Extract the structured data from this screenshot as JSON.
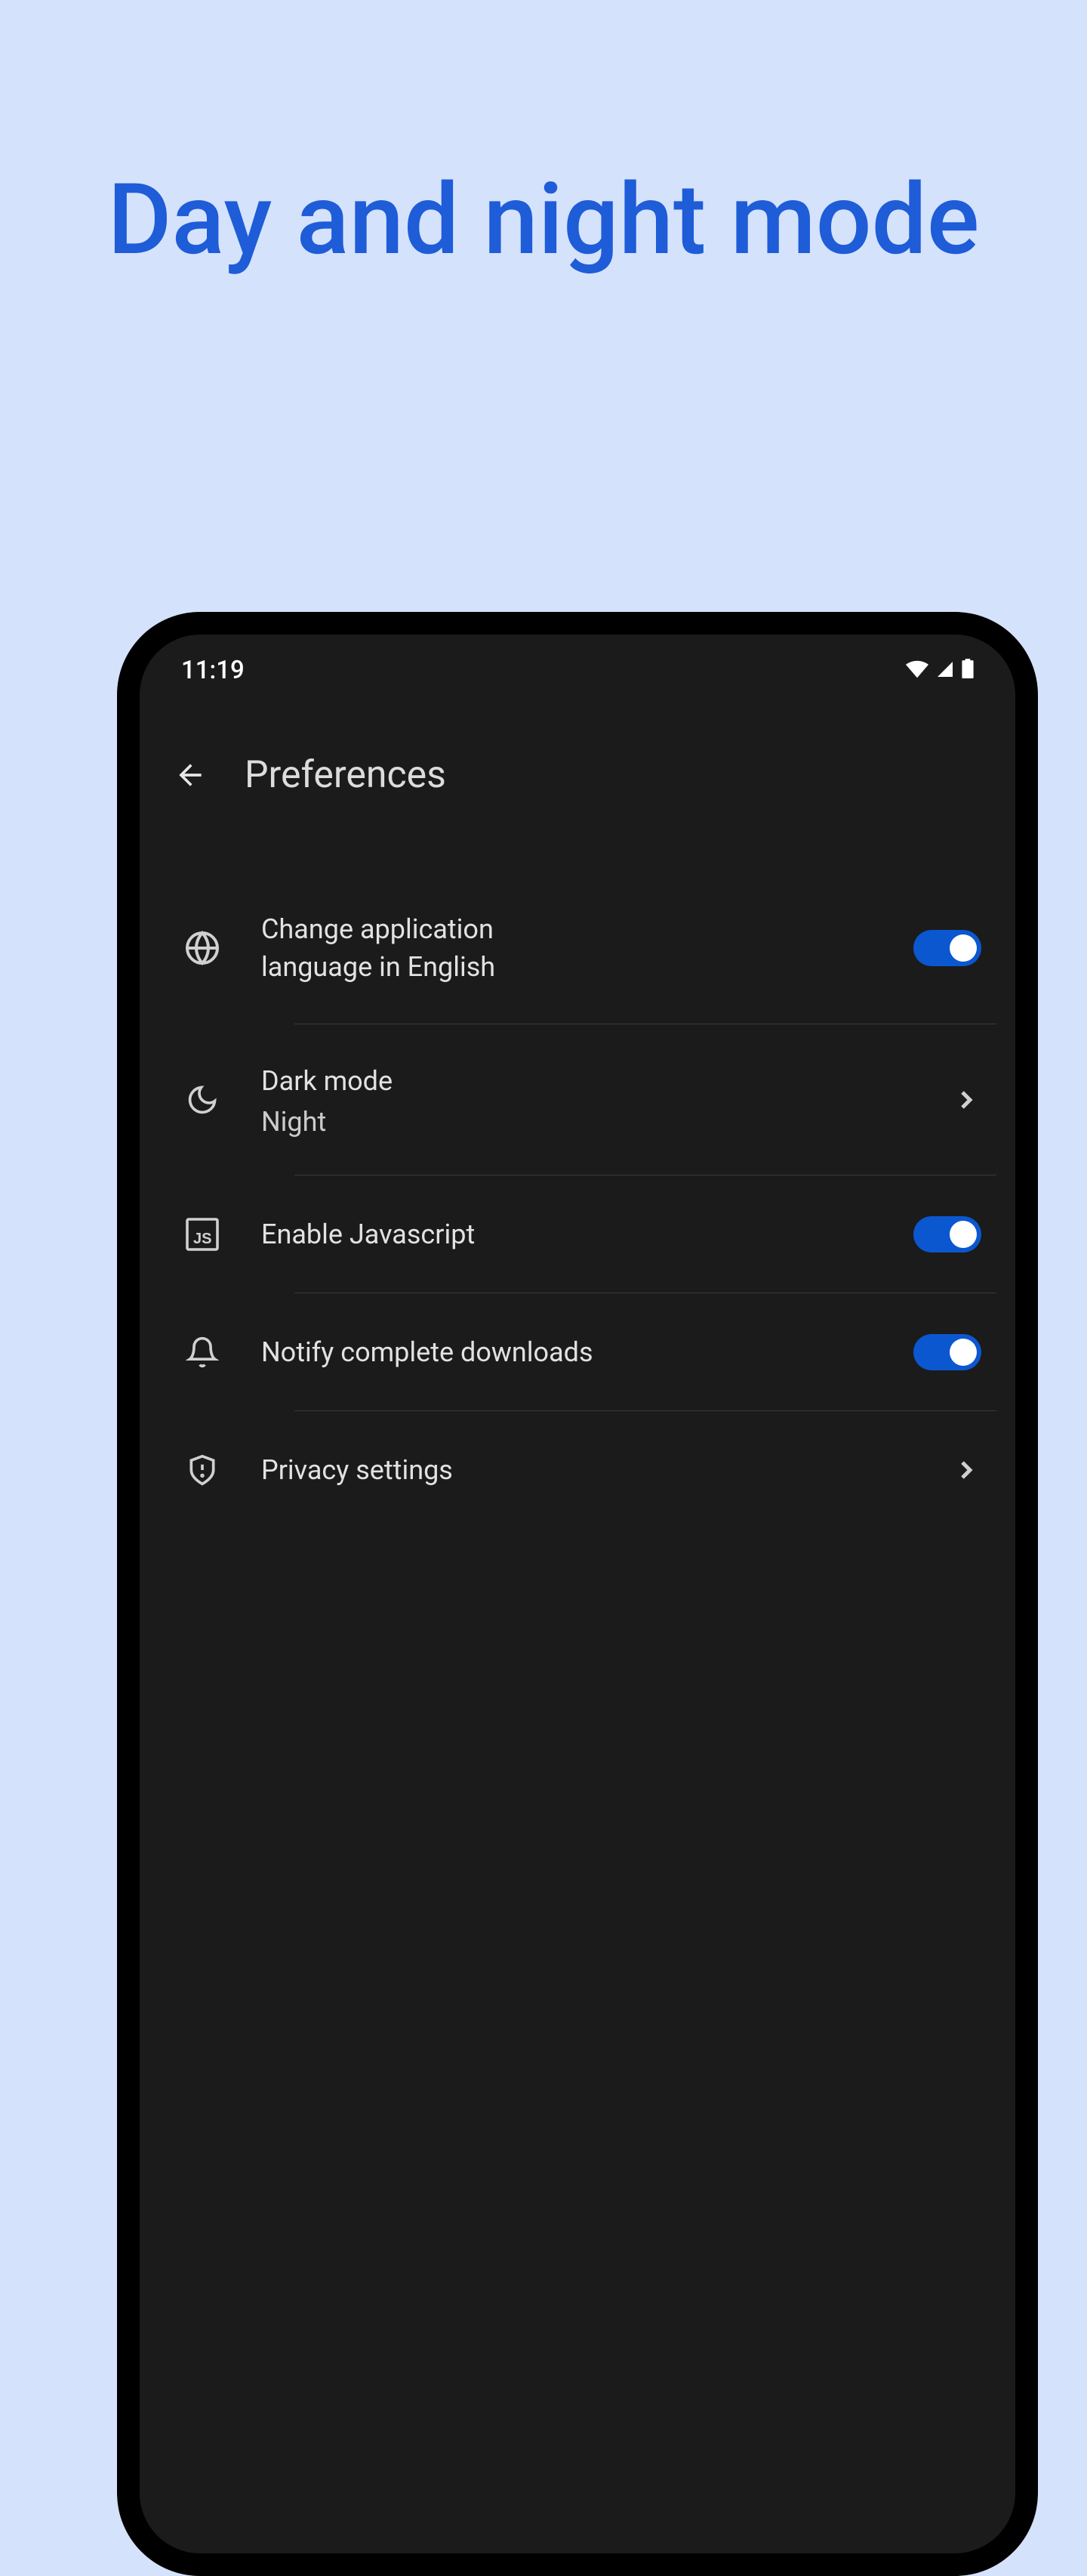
{
  "page": {
    "title": "Day and night mode"
  },
  "statusbar": {
    "time": "11:19"
  },
  "appbar": {
    "title": "Preferences"
  },
  "settings": {
    "language": {
      "title": "Change application language in English",
      "enabled": true
    },
    "darkmode": {
      "title": "Dark mode",
      "value": "Night"
    },
    "javascript": {
      "title": "Enable Javascript",
      "enabled": true
    },
    "notify": {
      "title": "Notify complete downloads",
      "enabled": true
    },
    "privacy": {
      "title": "Privacy settings"
    }
  }
}
